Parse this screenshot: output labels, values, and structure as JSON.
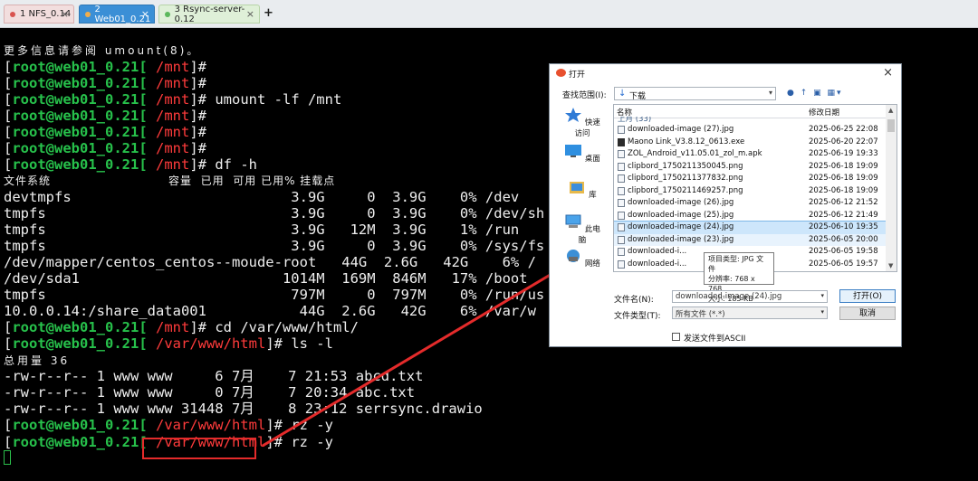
{
  "tabs": [
    {
      "label": "1 NFS_0.14",
      "dot": "#d9534f"
    },
    {
      "label": "2 Web01_0.21",
      "dot": "#f0ad4e"
    },
    {
      "label": "3 Rsync-server-0.12",
      "dot": "#5cb85c"
    }
  ],
  "tab_close": "×",
  "tab_add": "+",
  "terminal": {
    "line0": "更多信息请参阅 umount(8)。",
    "prompt_open": "[",
    "prompt_user": "root@web01_0.21[",
    "prompt_close": "]# ",
    "path_mnt": " /mnt",
    "path_www": " /var/www/html",
    "cmd_umount": "umount -lf /mnt",
    "cmd_df": "df -h",
    "df_header": "文件系统                           容量  已用  可用 已用% 挂载点",
    "df_rows": [
      "devtmpfs                          3.9G     0  3.9G    0% /dev",
      "tmpfs                             3.9G     0  3.9G    0% /dev/sh",
      "tmpfs                             3.9G   12M  3.9G    1% /run",
      "tmpfs                             3.9G     0  3.9G    0% /sys/fs",
      "/dev/mapper/centos_centos--moude-root   44G  2.6G   42G    6% /",
      "/dev/sda1                        1014M  169M  846M   17% /boot",
      "tmpfs                             797M     0  797M    0% /run/us",
      "10.0.0.14:/share_data001           44G  2.6G   42G    6% /var/w"
    ],
    "cmd_cd": "cd /var/www/html/",
    "cmd_ls": "ls -l",
    "total": "总用量 36",
    "ls_rows": [
      "-rw-r--r-- 1 www www     6 7月    7 21:53 abcd.txt",
      "-rw-r--r-- 1 www www     0 7月    7 20:34 abc.txt",
      "-rw-r--r-- 1 www www 31448 7月    8 23:12 serrsync.drawio"
    ],
    "cmd_rz": "rz -y"
  },
  "dialog": {
    "title": "打开",
    "close": "×",
    "lookin_label": "查找范围(I):",
    "lookin_value": "下载",
    "toolbar_icons": "● ↑ ▣ ▦▾",
    "places": [
      "快速访问",
      "桌面",
      "库",
      "此电脑",
      "网络"
    ],
    "col_name": "名称",
    "col_date": "修改日期",
    "partial_row": "上月 (33)",
    "files": [
      {
        "name": "downloaded-image (27).jpg",
        "date": "2025-06-25 22:08"
      },
      {
        "name": "Maono Link_V3.8.12_0613.exe",
        "date": "2025-06-20 22:07"
      },
      {
        "name": "ZOL_Android_v11.05.01_zol_m.apk",
        "date": "2025-06-19 19:33"
      },
      {
        "name": "clipbord_1750211350045.png",
        "date": "2025-06-18 19:09"
      },
      {
        "name": "clipbord_1750211377832.png",
        "date": "2025-06-18 19:09"
      },
      {
        "name": "clipbord_1750211469257.png",
        "date": "2025-06-18 19:09"
      },
      {
        "name": "downloaded-image (26).jpg",
        "date": "2025-06-12 21:52"
      },
      {
        "name": "downloaded-image (25).jpg",
        "date": "2025-06-12 21:49"
      },
      {
        "name": "downloaded-image (24).jpg",
        "date": "2025-06-10 19:35"
      },
      {
        "name": "downloaded-image (23).jpg",
        "date": "2025-06-05 20:00"
      },
      {
        "name": "downloaded-i...",
        "date": "2025-06-05 19:58"
      },
      {
        "name": "downloaded-i...",
        "date": "2025-06-05 19:57"
      }
    ],
    "tooltip": [
      "项目类型: JPG 文件",
      "分辨率: 768 x 768",
      "大小: 185 KB"
    ],
    "filename_label": "文件名(N):",
    "filename_value": "downloaded-image (24).jpg",
    "filetype_label": "文件类型(T):",
    "filetype_value": "所有文件 (*.*)",
    "open_btn": "打开(O)",
    "cancel_btn": "取消",
    "ascii_label": "发送文件到ASCII"
  },
  "colors": {
    "terminal_bg": "#000000",
    "prompt_green": "#27c14b",
    "path_red": "#ff3b3b",
    "annotation_red": "#e42b2b",
    "selection": "#cde6fb"
  }
}
